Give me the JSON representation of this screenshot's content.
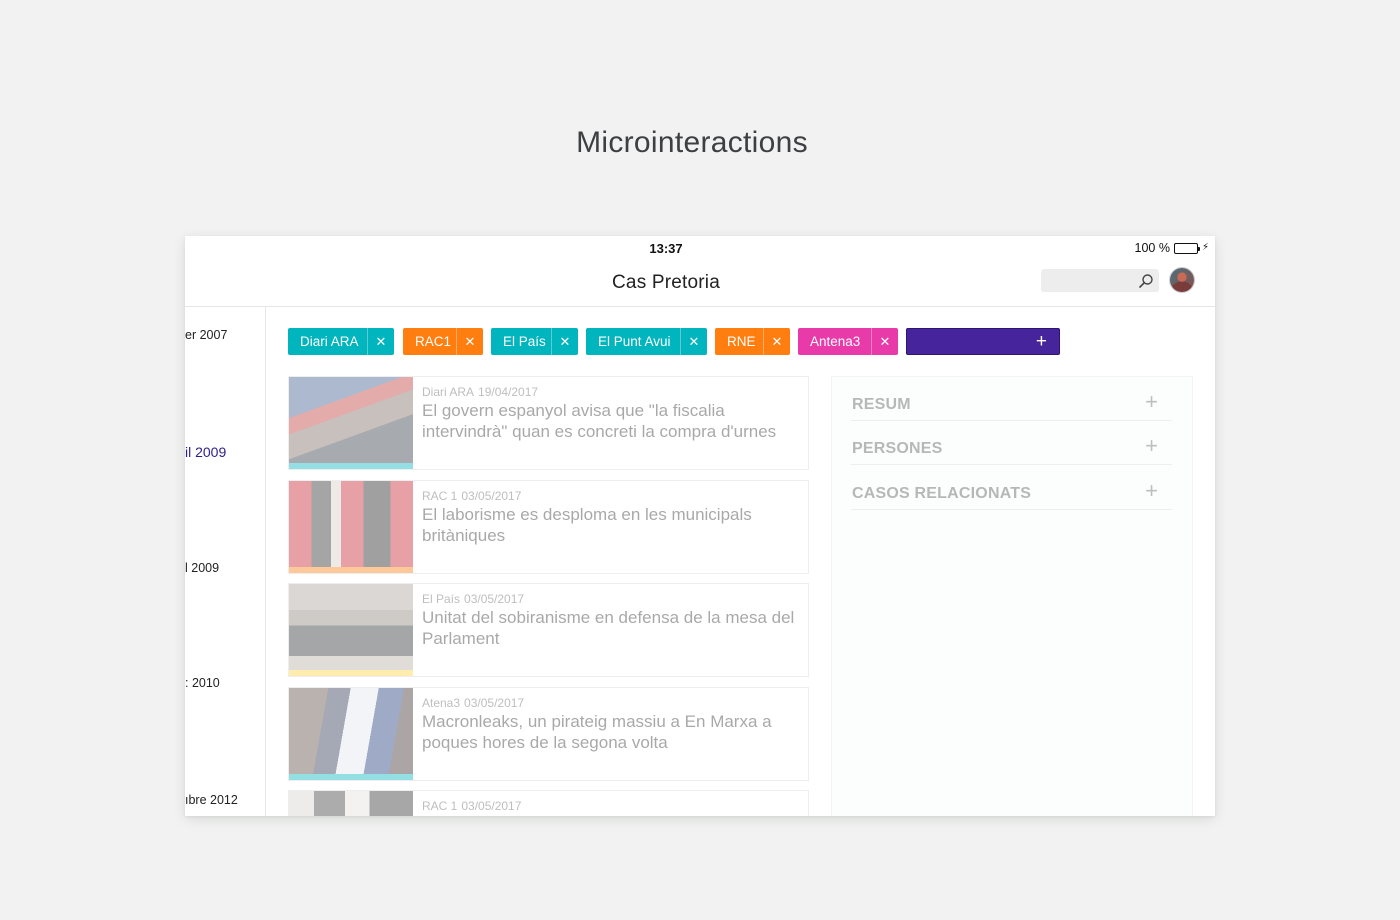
{
  "page": {
    "heading": "Microinteractions"
  },
  "status_bar": {
    "time": "13:37",
    "battery": "100 %"
  },
  "nav": {
    "title": "Cas Pretoria",
    "search_placeholder": ""
  },
  "timeline": {
    "items": [
      {
        "label": "er 2007",
        "active": false
      },
      {
        "label": "il 2009",
        "active": true
      },
      {
        "label": "l 2009",
        "active": false
      },
      {
        "label": ": 2010",
        "active": false
      },
      {
        "label": "ıbre 2012",
        "active": false
      }
    ]
  },
  "filters": {
    "chips": [
      {
        "label": "Diari ARA",
        "color": "#00b5bd",
        "remove": "✕"
      },
      {
        "label": "RAC1",
        "color": "#ff7e0f",
        "remove": "✕"
      },
      {
        "label": "El País",
        "color": "#00b5bd",
        "remove": "✕"
      },
      {
        "label": "El Punt Avui",
        "color": "#00b5bd",
        "remove": "✕"
      },
      {
        "label": "RNE",
        "color": "#ff7e0f",
        "remove": "✕"
      },
      {
        "label": "Antena3",
        "color": "#e83aa8",
        "remove": "✕"
      }
    ],
    "add_symbol": "+",
    "add_color": "#46249c"
  },
  "articles": [
    {
      "source": "Diari ARA",
      "date": "19/04/2017",
      "title": "El govern espanyol avisa que \"la fiscalia intervindrà\" quan es concreti la compra d'urnes",
      "stripe_color": "#00b5bd"
    },
    {
      "source": "RAC 1",
      "date": "03/05/2017",
      "title": "El laborisme es desploma en les municipals britàniques",
      "stripe_color": "#ff7e0f"
    },
    {
      "source": "El País",
      "date": "03/05/2017",
      "title": "Unitat del sobiranisme en defensa de la mesa del Parlament",
      "stripe_color": "#ffd23f"
    },
    {
      "source": "Atena3",
      "date": "03/05/2017",
      "title": "Macronleaks, un pirateig massiu a En Marxa a poques hores de la segona volta",
      "stripe_color": "#00b5bd"
    },
    {
      "source": "RAC 1",
      "date": "03/05/2017",
      "title": "",
      "stripe_color": "#ff7e0f"
    }
  ],
  "panel": {
    "sections": [
      {
        "label": "RESUM",
        "icon": "+"
      },
      {
        "label": "PERSONES",
        "icon": "+"
      },
      {
        "label": "CASOS RELACIONATS",
        "icon": "+"
      }
    ]
  }
}
